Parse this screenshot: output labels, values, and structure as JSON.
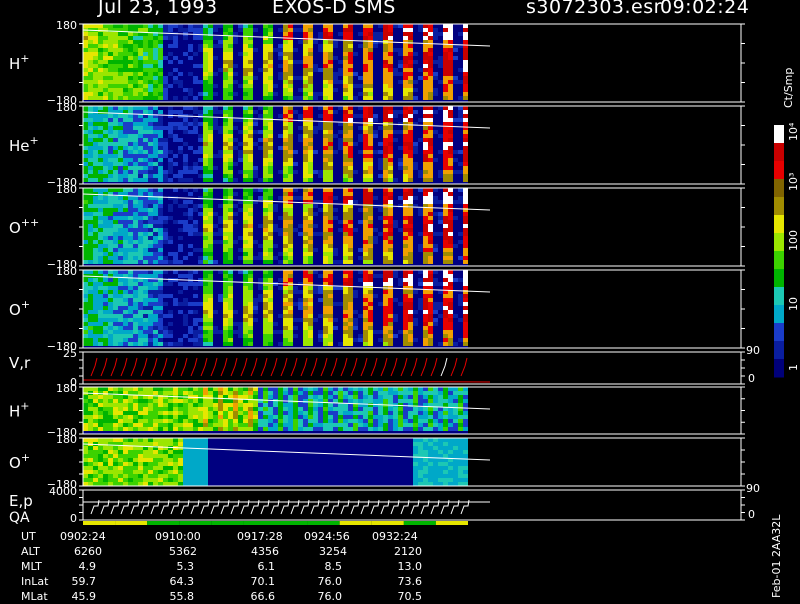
{
  "header": {
    "date": "Jul 23, 1993",
    "instrument": "EXOS-D SMS",
    "file": "s3072303.esr",
    "time": "09:02:24"
  },
  "colorbar": {
    "unit": "Ct/Smp",
    "ticks": [
      "1",
      "10",
      "100",
      "10³",
      "10⁴"
    ]
  },
  "side_label": "Feb-01 2AA32L",
  "chart_data": {
    "type": "heatmap",
    "panels": [
      {
        "id": "h-plus-top",
        "label": "H",
        "charge": "+",
        "ymax": "180",
        "ymin": "−180"
      },
      {
        "id": "he-plus",
        "label": "He",
        "charge": "+",
        "ymax": "180",
        "ymin": "−180"
      },
      {
        "id": "o-plusplus",
        "label": "O",
        "charge": "++",
        "ymax": "180",
        "ymin": "−180"
      },
      {
        "id": "o-plus-top",
        "label": "O",
        "charge": "+",
        "ymax": "180",
        "ymin": "−180"
      },
      {
        "id": "vr",
        "label": "V,r",
        "ymax": "25",
        "ymin": "0",
        "right_max": "90",
        "right_min": "0"
      },
      {
        "id": "h-plus-bottom",
        "label": "H",
        "charge": "+",
        "ymax": "180",
        "ymin": "−180"
      },
      {
        "id": "o-plus-bottom",
        "label": "O",
        "charge": "+",
        "ymax": "180",
        "ymin": "−180"
      },
      {
        "id": "ep",
        "label": "E,p",
        "label2": "QA",
        "ymax": "4000",
        "ymin": "0",
        "right_max": "90",
        "right_min": "0"
      }
    ],
    "ephemeris": {
      "labels": [
        "UT",
        "ALT",
        "MLT",
        "InLat",
        "MLat"
      ],
      "columns": [
        {
          "UT": "0902:24",
          "ALT": "6260",
          "MLT": "4.9",
          "InLat": "59.7",
          "MLat": "45.9"
        },
        {
          "UT": "0910:00",
          "ALT": "5362",
          "MLT": "5.3",
          "InLat": "64.3",
          "MLat": "55.8"
        },
        {
          "UT": "0917:28",
          "ALT": "4356",
          "MLT": "6.1",
          "InLat": "70.1",
          "MLat": "66.6"
        },
        {
          "UT": "0924:56",
          "ALT": "3254",
          "MLT": "8.5",
          "InLat": "76.0",
          "MLat": "76.0"
        },
        {
          "UT": "0932:24",
          "ALT": "2120",
          "MLT": "13.0",
          "InLat": "73.6",
          "MLat": "70.5"
        }
      ]
    }
  }
}
